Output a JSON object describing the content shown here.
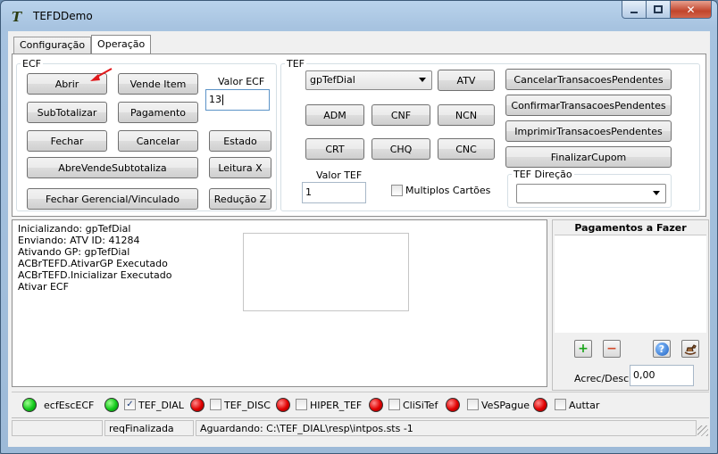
{
  "window": {
    "title": "TEFDDemo",
    "icon": "tefd-app-icon"
  },
  "caption": {
    "minimize": "min-glyph",
    "maximize": "max-glyph",
    "close": "✕"
  },
  "tabs": [
    {
      "label": "Configuração",
      "active": false
    },
    {
      "label": "Operação",
      "active": true
    }
  ],
  "ecf": {
    "legend": "ECF",
    "buttons": {
      "abrir": "Abrir",
      "vende_item": "Vende Item",
      "subtotalizar": "SubTotalizar",
      "pagamento": "Pagamento",
      "fechar": "Fechar",
      "cancelar": "Cancelar",
      "estado": "Estado",
      "abre_vende_subtotaliza": "AbreVendeSubtotaliza",
      "leitura_x": "Leitura X",
      "fechar_gerencial": "Fechar Gerencial/Vinculado",
      "reducao_z": "Redução Z"
    },
    "valor_label": "Valor ECF",
    "valor_value": "13"
  },
  "tef": {
    "legend": "TEF",
    "gp_selected": "gpTefDial",
    "buttons": {
      "atv": "ATV",
      "adm": "ADM",
      "cnf": "CNF",
      "ncn": "NCN",
      "crt": "CRT",
      "chq": "CHQ",
      "cnc": "CNC"
    },
    "valor_label": "Valor TEF",
    "valor_value": "1",
    "multiplos_label": "Multiplos Cartões",
    "side_buttons": {
      "cancelar_pendentes": "CancelarTransacoesPendentes",
      "confirmar_pendentes": "ConfirmarTransacoesPendentes",
      "imprimir_pendentes": "ImprimirTransacoesPendentes",
      "finalizar_cupom": "FinalizarCupom"
    },
    "direcao_legend": "TEF Direção",
    "direcao_value": ""
  },
  "log": {
    "lines": [
      "Inicializando: gpTefDial",
      "Enviando: ATV ID: 41284",
      "Ativando GP: gpTefDial",
      "ACBrTEFD.AtivarGP Executado",
      "ACBrTEFD.Inicializar Executado",
      "Ativar ECF"
    ]
  },
  "payments": {
    "title": "Pagamentos a Fazer",
    "acrec_label": "Acrec/Desc",
    "acrec_value": "0,00",
    "add_glyph": "+",
    "remove_glyph": "−",
    "help_glyph": "?",
    "icons": [
      "add-icon",
      "remove-icon",
      "help-icon",
      "rocking-horse-icon"
    ]
  },
  "indicators": [
    {
      "label": "ecfEscECF",
      "status": "green",
      "has_checkbox": false,
      "checked": false
    },
    {
      "label": "TEF_DIAL",
      "status": "green",
      "has_checkbox": true,
      "checked": true
    },
    {
      "label": "TEF_DISC",
      "status": "red",
      "has_checkbox": true,
      "checked": false
    },
    {
      "label": "HIPER_TEF",
      "status": "red",
      "has_checkbox": true,
      "checked": false
    },
    {
      "label": "CliSiTef",
      "status": "red",
      "has_checkbox": true,
      "checked": false
    },
    {
      "label": "VeSPague",
      "status": "red",
      "has_checkbox": true,
      "checked": false
    },
    {
      "label": "Auttar",
      "status": "red",
      "has_checkbox": true,
      "checked": false
    }
  ],
  "statusbar": {
    "panel1": "",
    "panel2": "reqFinalizada",
    "panel3": "Aguardando: C:\\TEF_DIAL\\resp\\intpos.sts -1"
  },
  "colors": {
    "accent_arrow": "#e0181b",
    "led_green": "#12c91a",
    "led_red": "#e00000"
  }
}
